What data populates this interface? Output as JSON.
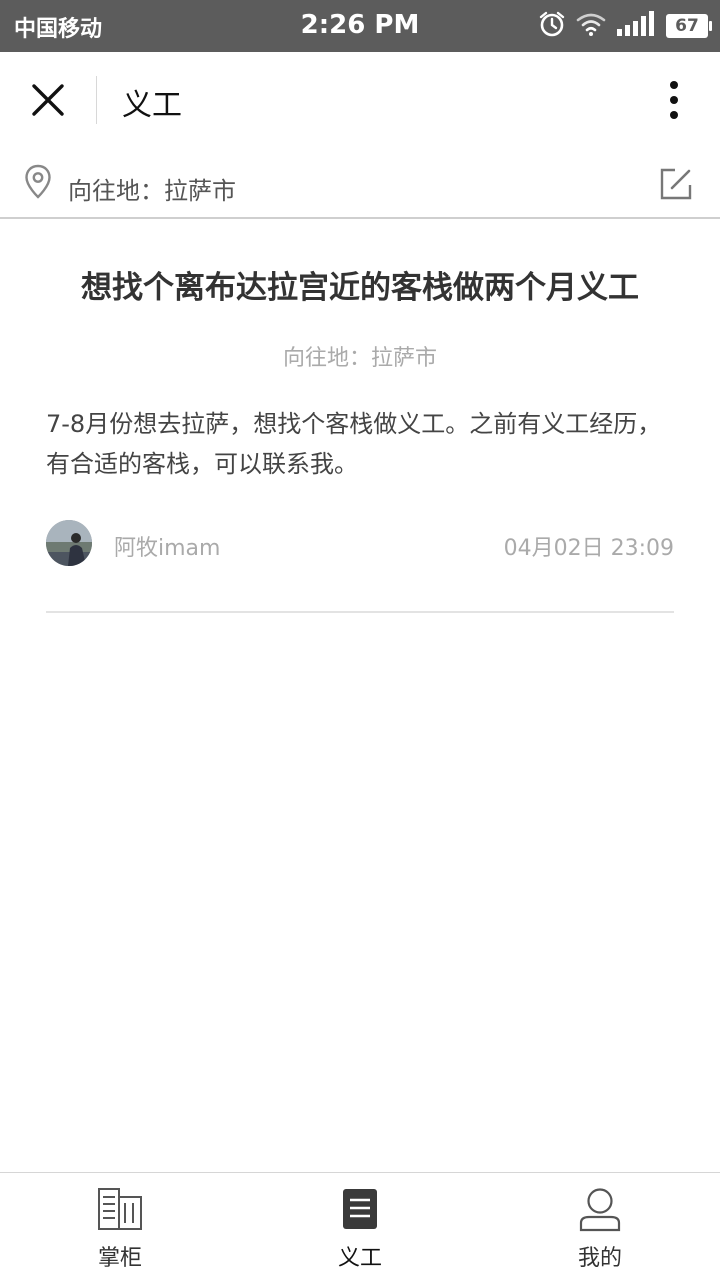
{
  "status_bar": {
    "carrier": "中国移动",
    "time": "2:26 PM",
    "battery": "67"
  },
  "title_bar": {
    "title": "义工"
  },
  "destination_bar": {
    "label": "向往地：拉萨市"
  },
  "post": {
    "title": "想找个离布达拉宫近的客栈做两个月义工",
    "destination": "向往地：拉萨市",
    "body": "7-8月份想去拉萨，想找个客栈做义工。之前有义工经历，有合适的客栈，可以联系我。",
    "author": "阿牧imam",
    "time": "04月02日 23:09"
  },
  "tabs": [
    {
      "label": "掌柜",
      "icon": "book-icon"
    },
    {
      "label": "义工",
      "icon": "document-icon",
      "active": true
    },
    {
      "label": "我的",
      "icon": "user-icon"
    }
  ]
}
